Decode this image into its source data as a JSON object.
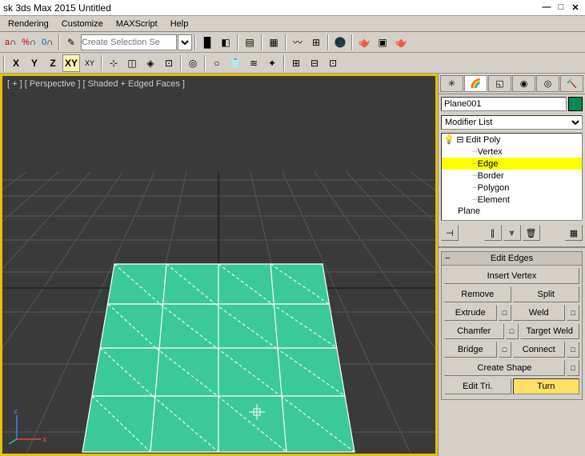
{
  "window": {
    "title": "sk 3ds Max 2015   Untitled"
  },
  "menu": {
    "items": [
      "Rendering",
      "Customize",
      "MAXScript",
      "Help"
    ]
  },
  "toolbar1": {
    "selection_set_placeholder": "Create Selection Se"
  },
  "toolbar2": {
    "axes": [
      "X",
      "Y",
      "Z",
      "XY",
      "XY"
    ]
  },
  "viewport": {
    "label": "[ + ] [ Perspective ] [ Shaded + Edged Faces ]"
  },
  "rightpanel": {
    "object_name": "Plane001",
    "modifier_list_label": "Modifier List",
    "stack": {
      "root": "Edit Poly",
      "subobjects": [
        "Vertex",
        "Edge",
        "Border",
        "Polygon",
        "Element"
      ],
      "selected": "Edge",
      "base": "Plane"
    },
    "rollouts": {
      "edit_edges": {
        "title": "Edit Edges",
        "insert_vertex": "Insert Vertex",
        "remove": "Remove",
        "split": "Split",
        "extrude": "Extrude",
        "weld": "Weld",
        "chamfer": "Chamfer",
        "target_weld": "Target Weld",
        "bridge": "Bridge",
        "connect": "Connect",
        "create_shape": "Create Shape",
        "edit_tri": "Edit Tri.",
        "turn": "Turn"
      }
    }
  }
}
